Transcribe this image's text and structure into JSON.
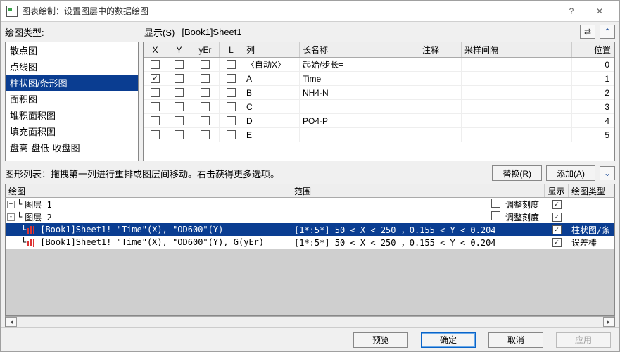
{
  "window": {
    "title": "图表绘制：设置图层中的数据绘图"
  },
  "left": {
    "label": "绘图类型:",
    "items": [
      "散点图",
      "点线图",
      "柱状图/条形图",
      "面积图",
      "堆积面积图",
      "填充面积图",
      "盘高-盘低-收盘图"
    ],
    "selected_index": 2
  },
  "top": {
    "show_label": "显示(S)",
    "book": "[Book1]Sheet1"
  },
  "grid": {
    "headers": {
      "x": "X",
      "y": "Y",
      "yer": "yEr",
      "l": "L",
      "col": "列",
      "long": "长名称",
      "ann": "注释",
      "si": "采样间隔",
      "pos": "位置"
    },
    "rows": [
      {
        "x": false,
        "y": false,
        "yer": false,
        "l": false,
        "col": "〈自动X〉",
        "long": "起始/步长=",
        "pos": "0"
      },
      {
        "x": true,
        "y": false,
        "yer": false,
        "l": false,
        "col": "A",
        "long": "Time",
        "pos": "1"
      },
      {
        "x": false,
        "y": false,
        "yer": false,
        "l": false,
        "col": "B",
        "long": "NH4-N",
        "pos": "2"
      },
      {
        "x": false,
        "y": false,
        "yer": false,
        "l": false,
        "col": "C",
        "long": "",
        "pos": "3"
      },
      {
        "x": false,
        "y": false,
        "yer": false,
        "l": false,
        "col": "D",
        "long": "PO4-P",
        "pos": "4"
      },
      {
        "x": false,
        "y": false,
        "yer": false,
        "l": false,
        "col": "E",
        "long": "",
        "pos": "5"
      }
    ]
  },
  "midbar": {
    "text": "图形列表：拖拽第一列进行重排或图层间移动。右击获得更多选项。",
    "replace": "替换(R)",
    "add": "添加(A)"
  },
  "bottom": {
    "headers": {
      "plot": "绘图",
      "range": "范围",
      "show": "显示",
      "ptype": "绘图类型"
    },
    "layers": [
      {
        "toggle": "+",
        "label": "图层 1",
        "adj": "调整刻度",
        "adj_checked": false,
        "show": true
      },
      {
        "toggle": "-",
        "label": "图层 2",
        "adj": "调整刻度",
        "adj_checked": false,
        "show": true
      }
    ],
    "plots": [
      {
        "sel": true,
        "text": "[Book1]Sheet1! \"Time\"(X), \"OD600\"(Y)",
        "range": "[1*:5*]   50 < X < 250 ，0.155 < Y < 0.204",
        "show": true,
        "ptype": "柱状图/条"
      },
      {
        "sel": false,
        "text": "[Book1]Sheet1! \"Time\"(X), \"OD600\"(Y), G(yEr)",
        "range": "[1*:5*]   50 < X < 250 ，0.155 < Y < 0.204",
        "show": true,
        "ptype": "误差棒"
      }
    ]
  },
  "footer": {
    "preview": "预览",
    "ok": "确定",
    "cancel": "取消",
    "apply": "应用"
  }
}
